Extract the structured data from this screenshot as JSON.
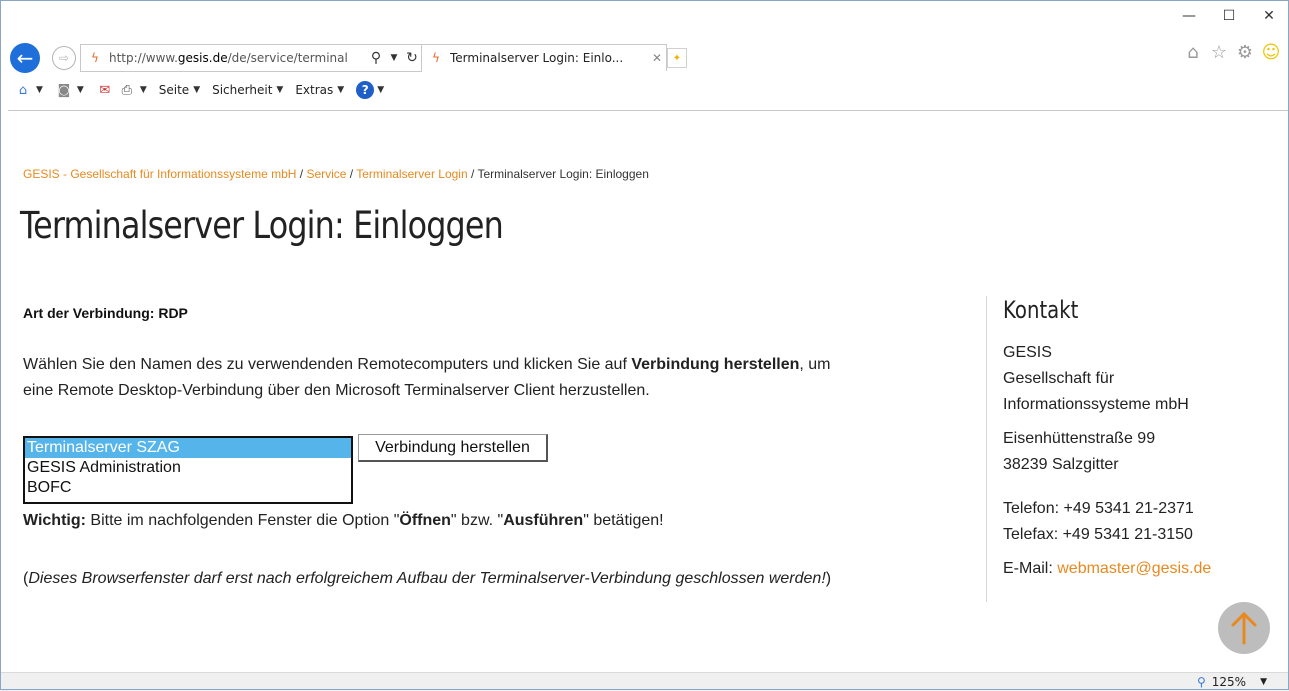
{
  "window": {
    "minimize": "—",
    "maximize": "☐",
    "close": "✕"
  },
  "nav": {
    "back_icon": "back-arrow-icon",
    "forward_icon": "forward-arrow-icon"
  },
  "address": {
    "url_prefix": "http://www.",
    "url_domain": "gesis.de",
    "url_rest": "/de/service/terminal"
  },
  "tab": {
    "title": "Terminalserver Login: Einlo...",
    "close": "✕"
  },
  "cmdbar": {
    "seite": "Seite",
    "sicherheit": "Sicherheit",
    "extras": "Extras"
  },
  "breadcrumb": {
    "item1": "GESIS - Gesellschaft für Informationssysteme mbH",
    "sep": " / ",
    "item2": "Service",
    "item3": "Terminalserver Login",
    "current": "Terminalserver Login: Einloggen"
  },
  "page": {
    "title": "Terminalserver Login: Einloggen",
    "conn_type": "Art der Verbindung: RDP",
    "desc_part1": "Wählen Sie den Namen des zu verwendenden Remotecomputers und klicken Sie auf ",
    "desc_bold": "Verbindung herstellen",
    "desc_part2": ", um eine Remote Desktop-Verbindung über den Microsoft Terminalserver Client herzustellen.",
    "servers": [
      "Terminalserver SZAG",
      "GESIS Administration",
      "BOFC"
    ],
    "connect_button": "Verbindung herstellen",
    "important_label": "Wichtig:",
    "important_text1": " Bitte im nachfolgenden Fenster die Option \"",
    "important_opt1": "Öffnen",
    "important_text2": "\" bzw. \"",
    "important_opt2": "Ausführen",
    "important_text3": "\" betätigen!",
    "note_open": "(",
    "note_italic": "Dieses Browserfenster darf erst nach erfolgreichem Aufbau der Terminalserver-Verbindung geschlossen werden!",
    "note_close": ")"
  },
  "contact": {
    "title": "Kontakt",
    "org1": "GESIS",
    "org2": "Gesellschaft für",
    "org3": "Informationssysteme mbH",
    "street": "Eisenhüttenstraße 99",
    "city": "38239 Salzgitter",
    "phone": "Telefon: +49 5341 21-2371",
    "fax": "Telefax: +49 5341 21-3150",
    "email_label": "E-Mail: ",
    "email": "webmaster@gesis.de"
  },
  "status": {
    "zoom": "125%"
  }
}
